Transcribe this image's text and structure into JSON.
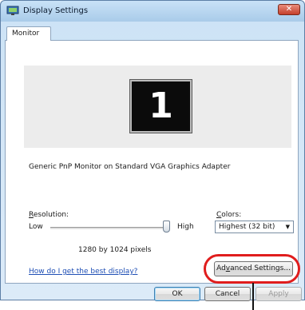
{
  "window": {
    "title": "Display Settings",
    "close_label": "✕"
  },
  "tabs": [
    {
      "label": "Monitor"
    }
  ],
  "monitor": {
    "number": "1",
    "description": "Generic PnP Monitor on Standard VGA Graphics Adapter"
  },
  "resolution": {
    "label": "Resolution:",
    "low_label": "Low",
    "high_label": "High",
    "value_text": "1280 by 1024 pixels",
    "slider_level": 1.0
  },
  "colors": {
    "label": "Colors:",
    "selected": "Highest (32 bit)",
    "dropdown_icon": "▼"
  },
  "help_link": "How do I get the best display?",
  "buttons": {
    "advanced": "Advanced Settings...",
    "ok": "OK",
    "cancel": "Cancel",
    "apply": "Apply"
  },
  "accent_colors": {
    "callout": "#e01d1d",
    "link": "#1f4fb5"
  }
}
